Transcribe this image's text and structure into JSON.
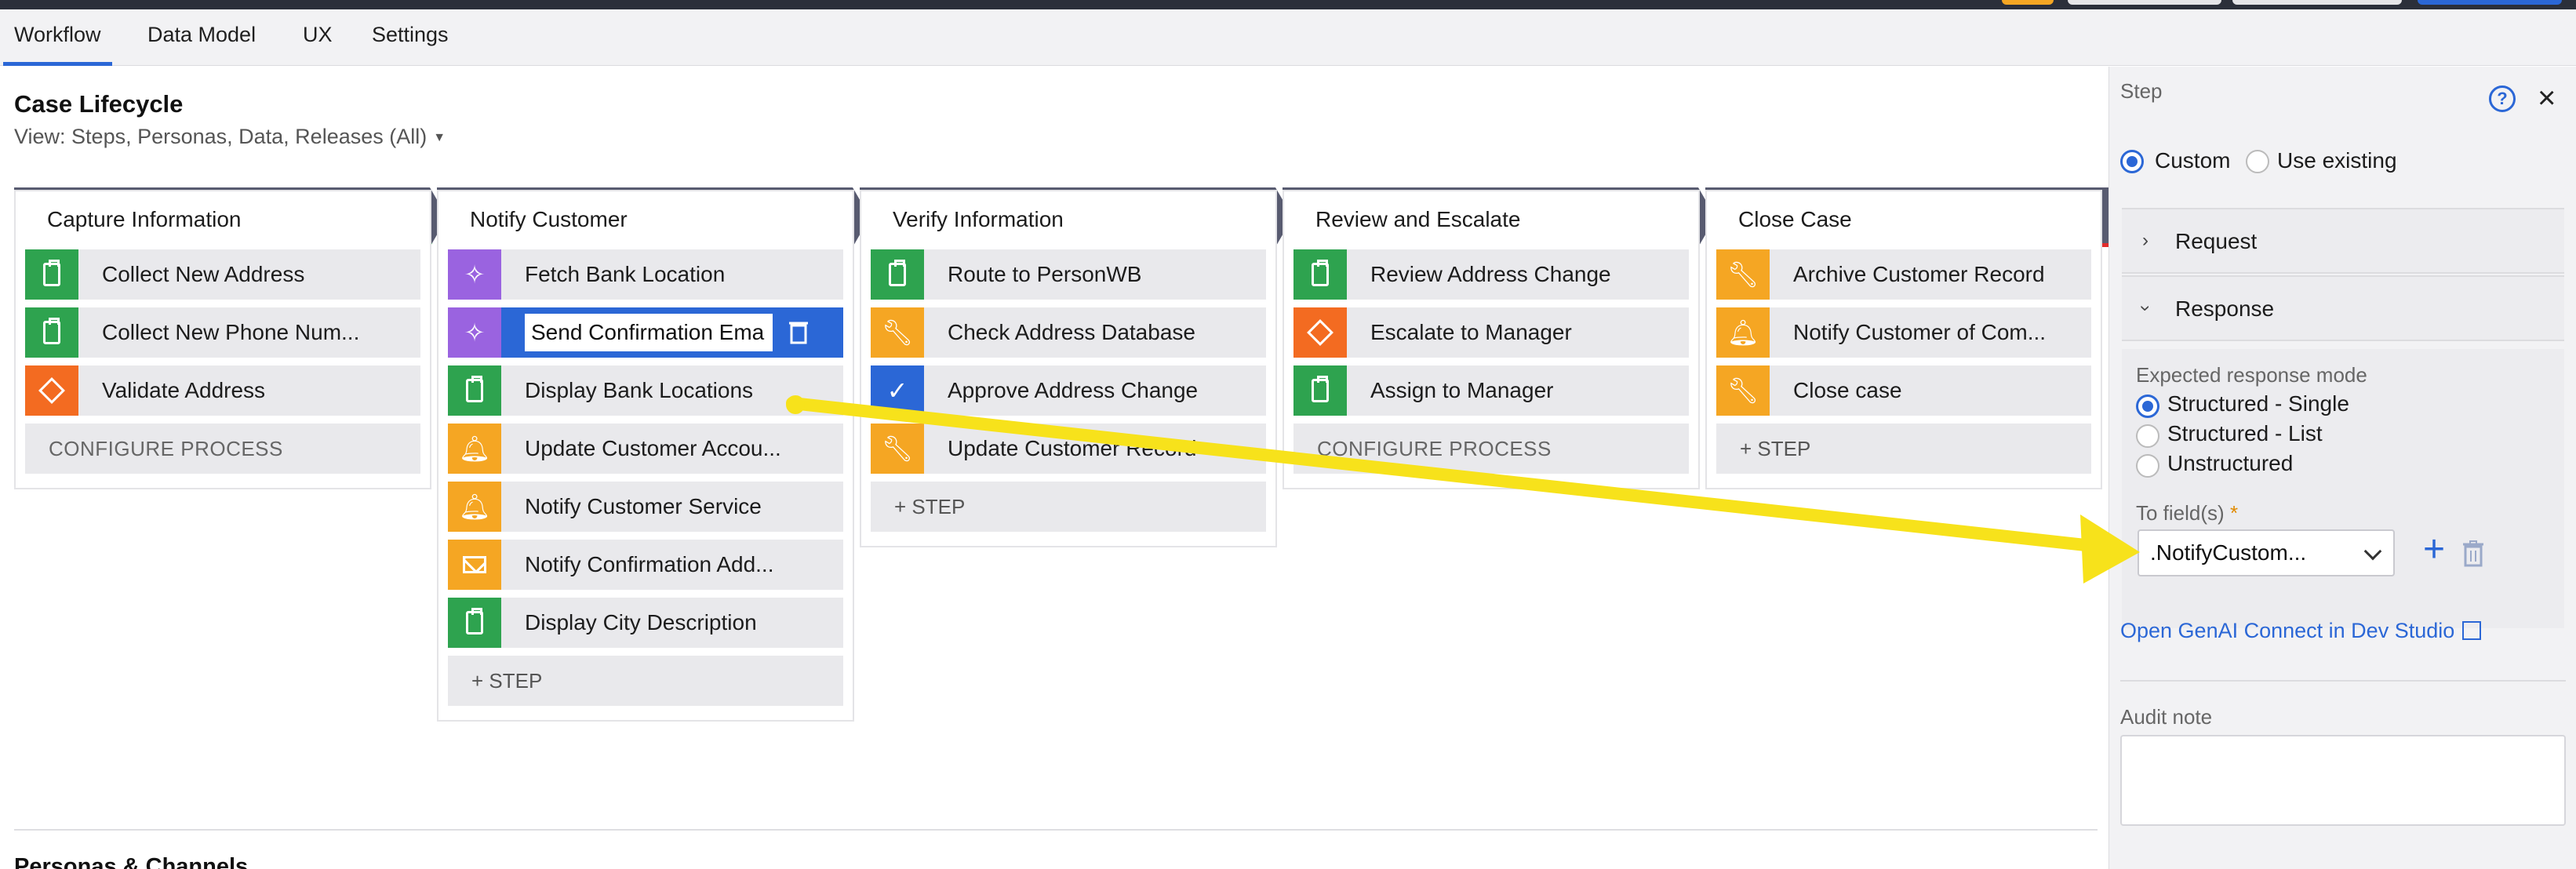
{
  "tabs": [
    {
      "label": "Workflow",
      "active": true
    },
    {
      "label": "Data Model",
      "active": false
    },
    {
      "label": "UX",
      "active": false
    },
    {
      "label": "Settings",
      "active": false
    }
  ],
  "page": {
    "title": "Case Lifecycle",
    "view_selector": "View: Steps, Personas, Data, Releases (All)",
    "personas_heading": "Personas & Channels"
  },
  "stages": [
    {
      "name": "Capture Information",
      "process": "Capture Information",
      "steps": [
        {
          "label": "Collect New Address",
          "icon": "clipboard-icon",
          "color": "#2ea34f"
        },
        {
          "label": "Collect New Phone Num...",
          "icon": "clipboard-icon",
          "color": "#2ea34f"
        },
        {
          "label": "Validate Address",
          "icon": "decision-diamond-icon",
          "color": "#f36b21"
        }
      ],
      "footer": "CONFIGURE PROCESS"
    },
    {
      "name": "Notify Customer",
      "process": "Notify Customer",
      "steps": [
        {
          "label": "Fetch Bank Location",
          "icon": "genai-sparkle-icon",
          "color": "#9a63e0"
        },
        {
          "label": "Send Confirmation Ema",
          "icon": "genai-sparkle-icon",
          "color": "#9a63e0"
        },
        {
          "label": "Display Bank Locations",
          "icon": "clipboard-icon",
          "color": "#2ea34f"
        },
        {
          "label": "Update Customer Accou...",
          "icon": "bell-icon",
          "color": "#f5a623"
        },
        {
          "label": "Notify Customer Service",
          "icon": "bell-icon",
          "color": "#f5a623"
        },
        {
          "label": "Notify Confirmation Add...",
          "icon": "envelope-icon",
          "color": "#f5a623"
        },
        {
          "label": "Display City Description",
          "icon": "clipboard-icon",
          "color": "#2ea34f"
        }
      ],
      "footer": "+ STEP"
    },
    {
      "name": "Verify Information",
      "process": "Verify Information",
      "steps": [
        {
          "label": "Route to PersonWB",
          "icon": "clipboard-icon",
          "color": "#2ea34f"
        },
        {
          "label": "Check Address Database",
          "icon": "wrench-icon",
          "color": "#f5a623"
        },
        {
          "label": "Approve Address Change",
          "icon": "checkmark-icon",
          "color": "#2b67d6"
        },
        {
          "label": "Update Customer Record",
          "icon": "wrench-icon",
          "color": "#f5a623"
        }
      ],
      "footer": "+ STEP"
    },
    {
      "name": "Review and Escalate",
      "process": "Review and Escalate",
      "steps": [
        {
          "label": "Review Address Change",
          "icon": "clipboard-icon",
          "color": "#2ea34f"
        },
        {
          "label": "Escalate to Manager",
          "icon": "decision-diamond-icon",
          "color": "#f36b21"
        },
        {
          "label": "Assign to Manager",
          "icon": "clipboard-icon",
          "color": "#2ea34f"
        }
      ],
      "footer": "CONFIGURE PROCESS"
    },
    {
      "name": "Close Case",
      "process": "Close Case",
      "steps": [
        {
          "label": "Archive Customer Record",
          "icon": "wrench-icon",
          "color": "#f5a623"
        },
        {
          "label": "Notify Customer of Com...",
          "icon": "bell-icon",
          "color": "#f5a623"
        },
        {
          "label": "Close case",
          "icon": "wrench-icon",
          "color": "#f5a623"
        }
      ],
      "footer": "+ STEP"
    }
  ],
  "editing_step_value": "Send Confirmation Ema",
  "panel": {
    "title": "Step",
    "help": "?",
    "close": "×",
    "mode_custom": "Custom",
    "mode_existing": "Use existing",
    "request_label": "Request",
    "response_label": "Response",
    "expected_mode_label": "Expected response mode",
    "options": [
      "Structured - Single",
      "Structured - List",
      "Unstructured"
    ],
    "selected_option": "Structured - Single",
    "to_fields_label": "To field(s)",
    "required_mark": "*",
    "field_value": ".NotifyCustom...",
    "link_label": "Open GenAI Connect in Dev Studio",
    "audit_label": "Audit note",
    "audit_value": ""
  },
  "colors": {
    "accent": "#2b67d6",
    "stage_header": "#585b70",
    "first_stage_underline": "#2ea34f",
    "last_stage_underline": "#e02b2b",
    "annotation_arrow": "#f7e21b"
  }
}
